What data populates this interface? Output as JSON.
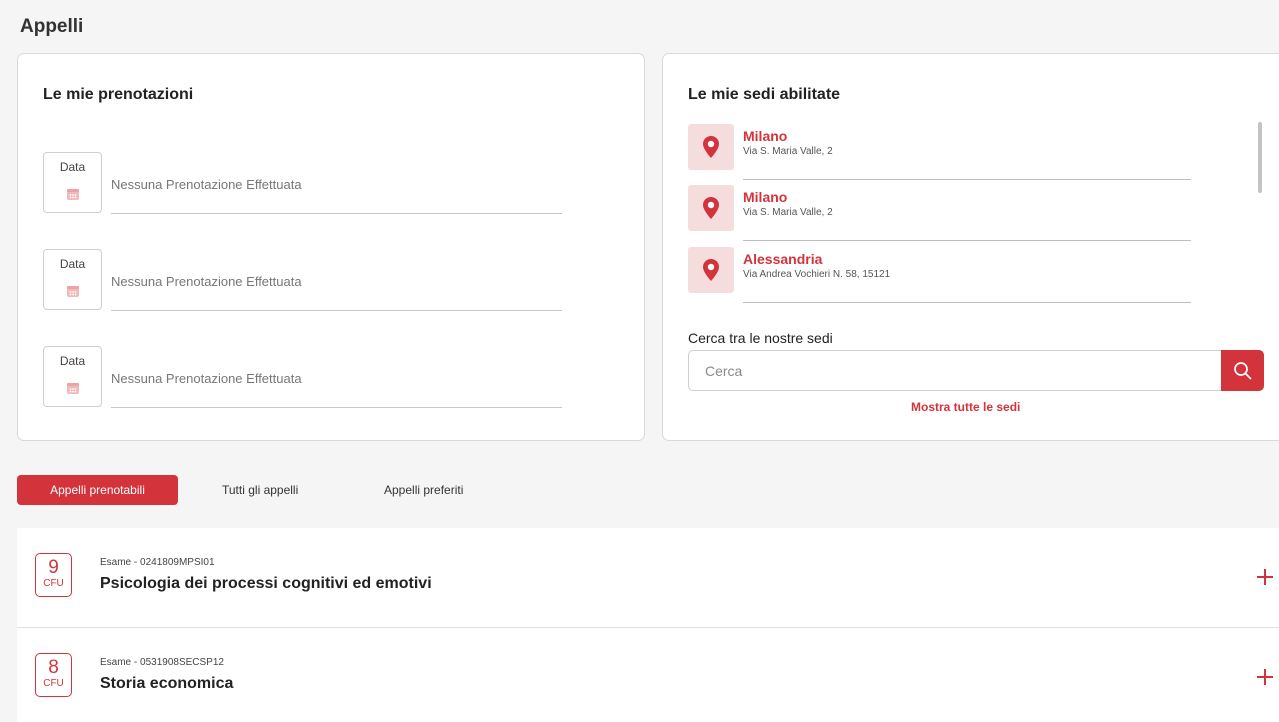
{
  "page": {
    "title": "Appelli"
  },
  "bookings": {
    "title": "Le mie prenotazioni",
    "items": [
      {
        "date_label": "Data",
        "text": "Nessuna Prenotazione Effettuata"
      },
      {
        "date_label": "Data",
        "text": "Nessuna Prenotazione Effettuata"
      },
      {
        "date_label": "Data",
        "text": "Nessuna Prenotazione Effettuata"
      }
    ]
  },
  "locations": {
    "title": "Le mie sedi abilitate",
    "items": [
      {
        "city": "Milano",
        "address": "Via S. Maria Valle, 2"
      },
      {
        "city": "Milano",
        "address": "Via S. Maria Valle, 2"
      },
      {
        "city": "Alessandria",
        "address": "Via Andrea Vochieri N. 58, 15121"
      }
    ],
    "search_label": "Cerca tra le nostre sedi",
    "search_placeholder": "Cerca",
    "show_all": "Mostra tutte le sedi"
  },
  "tabs": [
    {
      "label": "Appelli prenotabili",
      "active": true
    },
    {
      "label": "Tutti gli appelli",
      "active": false
    },
    {
      "label": "Appelli preferiti",
      "active": false
    }
  ],
  "exams": [
    {
      "cfu": "9",
      "cfu_label": "CFU",
      "code": "Esame - 0241809MPSI01",
      "name": "Psicologia dei processi cognitivi ed emotivi"
    },
    {
      "cfu": "8",
      "cfu_label": "CFU",
      "code": "Esame - 0531908SECSP12",
      "name": "Storia economica"
    }
  ],
  "icons": {
    "booking_date": "calendar-icon",
    "location": "map-pin-icon",
    "search": "search-icon",
    "expand": "plus-icon"
  },
  "colors": {
    "accent": "#d3343b",
    "pin_background": "#f5dcdd",
    "page_background": "#f5f5f5"
  }
}
